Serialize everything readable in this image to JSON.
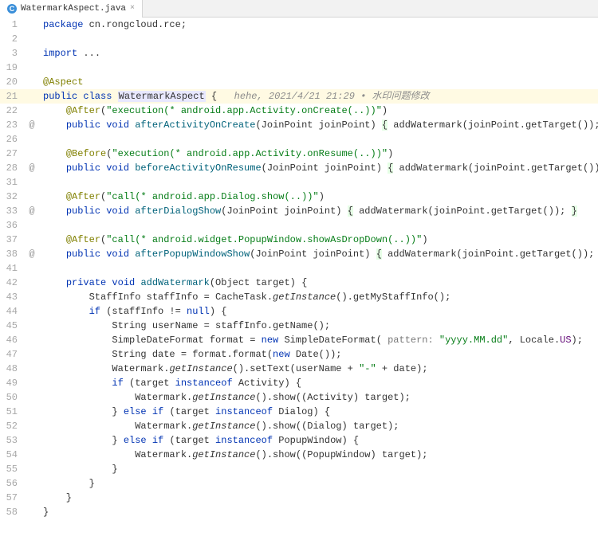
{
  "tab": {
    "filename": "WatermarkAspect.java",
    "icon_color": "#3a8fd9"
  },
  "lines": [
    {
      "n": 1,
      "m": "",
      "hl": false,
      "tokens": [
        [
          "kw",
          "package "
        ],
        [
          "id",
          "cn.rongcloud.rce"
        ],
        [
          "id",
          ";"
        ]
      ]
    },
    {
      "n": 2,
      "m": "",
      "hl": false,
      "tokens": []
    },
    {
      "n": 3,
      "m": "",
      "hl": false,
      "tokens": [
        [
          "kw",
          "import "
        ],
        [
          "id",
          "..."
        ]
      ]
    },
    {
      "n": 19,
      "m": "",
      "hl": false,
      "tokens": []
    },
    {
      "n": 20,
      "m": "",
      "hl": false,
      "tokens": [
        [
          "ann",
          "@Aspect"
        ]
      ]
    },
    {
      "n": 21,
      "m": "",
      "hl": true,
      "tokens": [
        [
          "kw",
          "public class "
        ],
        [
          "clsHi",
          "WatermarkAspect"
        ],
        [
          "id",
          " {   "
        ],
        [
          "cmt",
          "hehe, 2021/4/21 21:29 "
        ],
        [
          "dot",
          "•"
        ],
        [
          "cmt",
          " 水印问题修改"
        ]
      ]
    },
    {
      "n": 22,
      "m": "",
      "hl": false,
      "tokens": [
        [
          "id",
          "    "
        ],
        [
          "ann",
          "@After"
        ],
        [
          "id",
          "("
        ],
        [
          "str",
          "\"execution(* android.app.Activity.onCreate(..))\""
        ],
        [
          "id",
          ")"
        ]
      ]
    },
    {
      "n": 23,
      "m": "@",
      "hl": false,
      "tokens": [
        [
          "id",
          "    "
        ],
        [
          "kw",
          "public void "
        ],
        [
          "mtd",
          "afterActivityOnCreate"
        ],
        [
          "id",
          "(JoinPoint joinPoint) "
        ],
        [
          "br",
          "{"
        ],
        [
          "id",
          " addWatermark(joinPoint.getTarget()); "
        ],
        [
          "br",
          "}"
        ]
      ]
    },
    {
      "n": 26,
      "m": "",
      "hl": false,
      "tokens": []
    },
    {
      "n": 27,
      "m": "",
      "hl": false,
      "tokens": [
        [
          "id",
          "    "
        ],
        [
          "ann",
          "@Before"
        ],
        [
          "id",
          "("
        ],
        [
          "str",
          "\"execution(* android.app.Activity.onResume(..))\""
        ],
        [
          "id",
          ")"
        ]
      ]
    },
    {
      "n": 28,
      "m": "@",
      "hl": false,
      "tokens": [
        [
          "id",
          "    "
        ],
        [
          "kw",
          "public void "
        ],
        [
          "mtd",
          "beforeActivityOnResume"
        ],
        [
          "id",
          "(JoinPoint joinPoint) "
        ],
        [
          "br",
          "{"
        ],
        [
          "id",
          " addWatermark(joinPoint.getTarget()); "
        ],
        [
          "br",
          "}"
        ]
      ]
    },
    {
      "n": 31,
      "m": "",
      "hl": false,
      "tokens": []
    },
    {
      "n": 32,
      "m": "",
      "hl": false,
      "tokens": [
        [
          "id",
          "    "
        ],
        [
          "ann",
          "@After"
        ],
        [
          "id",
          "("
        ],
        [
          "str",
          "\"call(* android.app.Dialog.show(..))\""
        ],
        [
          "id",
          ")"
        ]
      ]
    },
    {
      "n": 33,
      "m": "@",
      "hl": false,
      "tokens": [
        [
          "id",
          "    "
        ],
        [
          "kw",
          "public void "
        ],
        [
          "mtd",
          "afterDialogShow"
        ],
        [
          "id",
          "(JoinPoint joinPoint) "
        ],
        [
          "br",
          "{"
        ],
        [
          "id",
          " addWatermark(joinPoint.getTarget()); "
        ],
        [
          "br",
          "}"
        ]
      ]
    },
    {
      "n": 36,
      "m": "",
      "hl": false,
      "tokens": []
    },
    {
      "n": 37,
      "m": "",
      "hl": false,
      "tokens": [
        [
          "id",
          "    "
        ],
        [
          "ann",
          "@After"
        ],
        [
          "id",
          "("
        ],
        [
          "str",
          "\"call(* android.widget.PopupWindow.showAsDropDown(..))\""
        ],
        [
          "id",
          ")"
        ]
      ]
    },
    {
      "n": 38,
      "m": "@",
      "hl": false,
      "tokens": [
        [
          "id",
          "    "
        ],
        [
          "kw",
          "public void "
        ],
        [
          "mtd",
          "afterPopupWindowShow"
        ],
        [
          "id",
          "(JoinPoint joinPoint) "
        ],
        [
          "br",
          "{"
        ],
        [
          "id",
          " addWatermark(joinPoint.getTarget()); "
        ],
        [
          "br",
          "}"
        ]
      ]
    },
    {
      "n": 41,
      "m": "",
      "hl": false,
      "tokens": []
    },
    {
      "n": 42,
      "m": "",
      "hl": false,
      "tokens": [
        [
          "id",
          "    "
        ],
        [
          "kw",
          "private void "
        ],
        [
          "mtd",
          "addWatermark"
        ],
        [
          "id",
          "(Object target) {"
        ]
      ]
    },
    {
      "n": 43,
      "m": "",
      "hl": false,
      "tokens": [
        [
          "id",
          "        StaffInfo staffInfo = CacheTask."
        ],
        [
          "stat",
          "getInstance"
        ],
        [
          "id",
          "().getMyStaffInfo();"
        ]
      ]
    },
    {
      "n": 44,
      "m": "",
      "hl": false,
      "tokens": [
        [
          "id",
          "        "
        ],
        [
          "kw",
          "if "
        ],
        [
          "id",
          "(staffInfo != "
        ],
        [
          "kw",
          "null"
        ],
        [
          "id",
          ") {"
        ]
      ]
    },
    {
      "n": 45,
      "m": "",
      "hl": false,
      "tokens": [
        [
          "id",
          "            String userName = staffInfo.getName();"
        ]
      ]
    },
    {
      "n": 46,
      "m": "",
      "hl": false,
      "tokens": [
        [
          "id",
          "            SimpleDateFormat format = "
        ],
        [
          "kw",
          "new "
        ],
        [
          "id",
          "SimpleDateFormat( "
        ],
        [
          "param",
          "pattern: "
        ],
        [
          "str",
          "\"yyyy.MM.dd\""
        ],
        [
          "id",
          ", Locale."
        ],
        [
          "field",
          "US"
        ],
        [
          "id",
          ");"
        ]
      ]
    },
    {
      "n": 47,
      "m": "",
      "hl": false,
      "tokens": [
        [
          "id",
          "            String date = format.format("
        ],
        [
          "kw",
          "new "
        ],
        [
          "id",
          "Date());"
        ]
      ]
    },
    {
      "n": 48,
      "m": "",
      "hl": false,
      "tokens": [
        [
          "id",
          "            Watermark."
        ],
        [
          "stat",
          "getInstance"
        ],
        [
          "id",
          "().setText(userName + "
        ],
        [
          "str",
          "\"-\""
        ],
        [
          "id",
          " + date);"
        ]
      ]
    },
    {
      "n": 49,
      "m": "",
      "hl": false,
      "tokens": [
        [
          "id",
          "            "
        ],
        [
          "kw",
          "if "
        ],
        [
          "id",
          "(target "
        ],
        [
          "kw",
          "instanceof "
        ],
        [
          "id",
          "Activity) {"
        ]
      ]
    },
    {
      "n": 50,
      "m": "",
      "hl": false,
      "tokens": [
        [
          "id",
          "                Watermark."
        ],
        [
          "stat",
          "getInstance"
        ],
        [
          "id",
          "().show((Activity) target);"
        ]
      ]
    },
    {
      "n": 51,
      "m": "",
      "hl": false,
      "tokens": [
        [
          "id",
          "            } "
        ],
        [
          "kw",
          "else if "
        ],
        [
          "id",
          "(target "
        ],
        [
          "kw",
          "instanceof "
        ],
        [
          "id",
          "Dialog) {"
        ]
      ]
    },
    {
      "n": 52,
      "m": "",
      "hl": false,
      "tokens": [
        [
          "id",
          "                Watermark."
        ],
        [
          "stat",
          "getInstance"
        ],
        [
          "id",
          "().show((Dialog) target);"
        ]
      ]
    },
    {
      "n": 53,
      "m": "",
      "hl": false,
      "tokens": [
        [
          "id",
          "            } "
        ],
        [
          "kw",
          "else if "
        ],
        [
          "id",
          "(target "
        ],
        [
          "kw",
          "instanceof "
        ],
        [
          "id",
          "PopupWindow) {"
        ]
      ]
    },
    {
      "n": 54,
      "m": "",
      "hl": false,
      "tokens": [
        [
          "id",
          "                Watermark."
        ],
        [
          "stat",
          "getInstance"
        ],
        [
          "id",
          "().show((PopupWindow) target);"
        ]
      ]
    },
    {
      "n": 55,
      "m": "",
      "hl": false,
      "tokens": [
        [
          "id",
          "            }"
        ]
      ]
    },
    {
      "n": 56,
      "m": "",
      "hl": false,
      "tokens": [
        [
          "id",
          "        }"
        ]
      ]
    },
    {
      "n": 57,
      "m": "",
      "hl": false,
      "tokens": [
        [
          "id",
          "    }"
        ]
      ]
    },
    {
      "n": 58,
      "m": "",
      "hl": false,
      "tokens": [
        [
          "id",
          "}"
        ]
      ]
    }
  ]
}
